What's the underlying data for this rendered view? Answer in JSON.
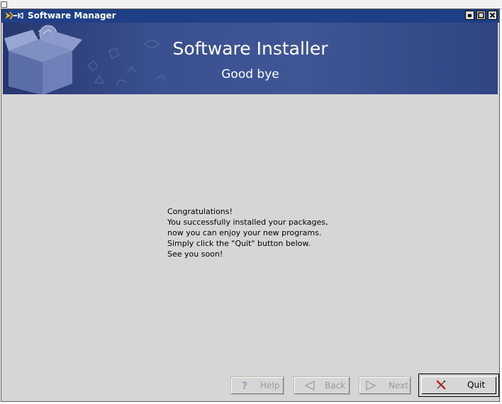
{
  "window": {
    "title": "Software Manager",
    "controls": [
      "minimize-icon",
      "maximize-icon",
      "close-icon"
    ]
  },
  "banner": {
    "title": "Software Installer",
    "subtitle": "Good bye",
    "colors": {
      "dark": "#25376e",
      "mid": "#3f5696"
    }
  },
  "message": {
    "lines": [
      "Congratulations!",
      "You successfully installed your packages,",
      "now you can enjoy your new programs.",
      "Simply click the \"Quit\" button below.",
      "See you soon!"
    ]
  },
  "buttons": {
    "help": {
      "label": "Help",
      "icon": "question-icon",
      "enabled": false
    },
    "back": {
      "label": "Back",
      "icon": "left-arrow-icon",
      "enabled": false
    },
    "next": {
      "label": "Next",
      "icon": "right-arrow-icon",
      "enabled": false
    },
    "quit": {
      "label": "Quit",
      "icon": "x-icon",
      "enabled": true
    }
  }
}
